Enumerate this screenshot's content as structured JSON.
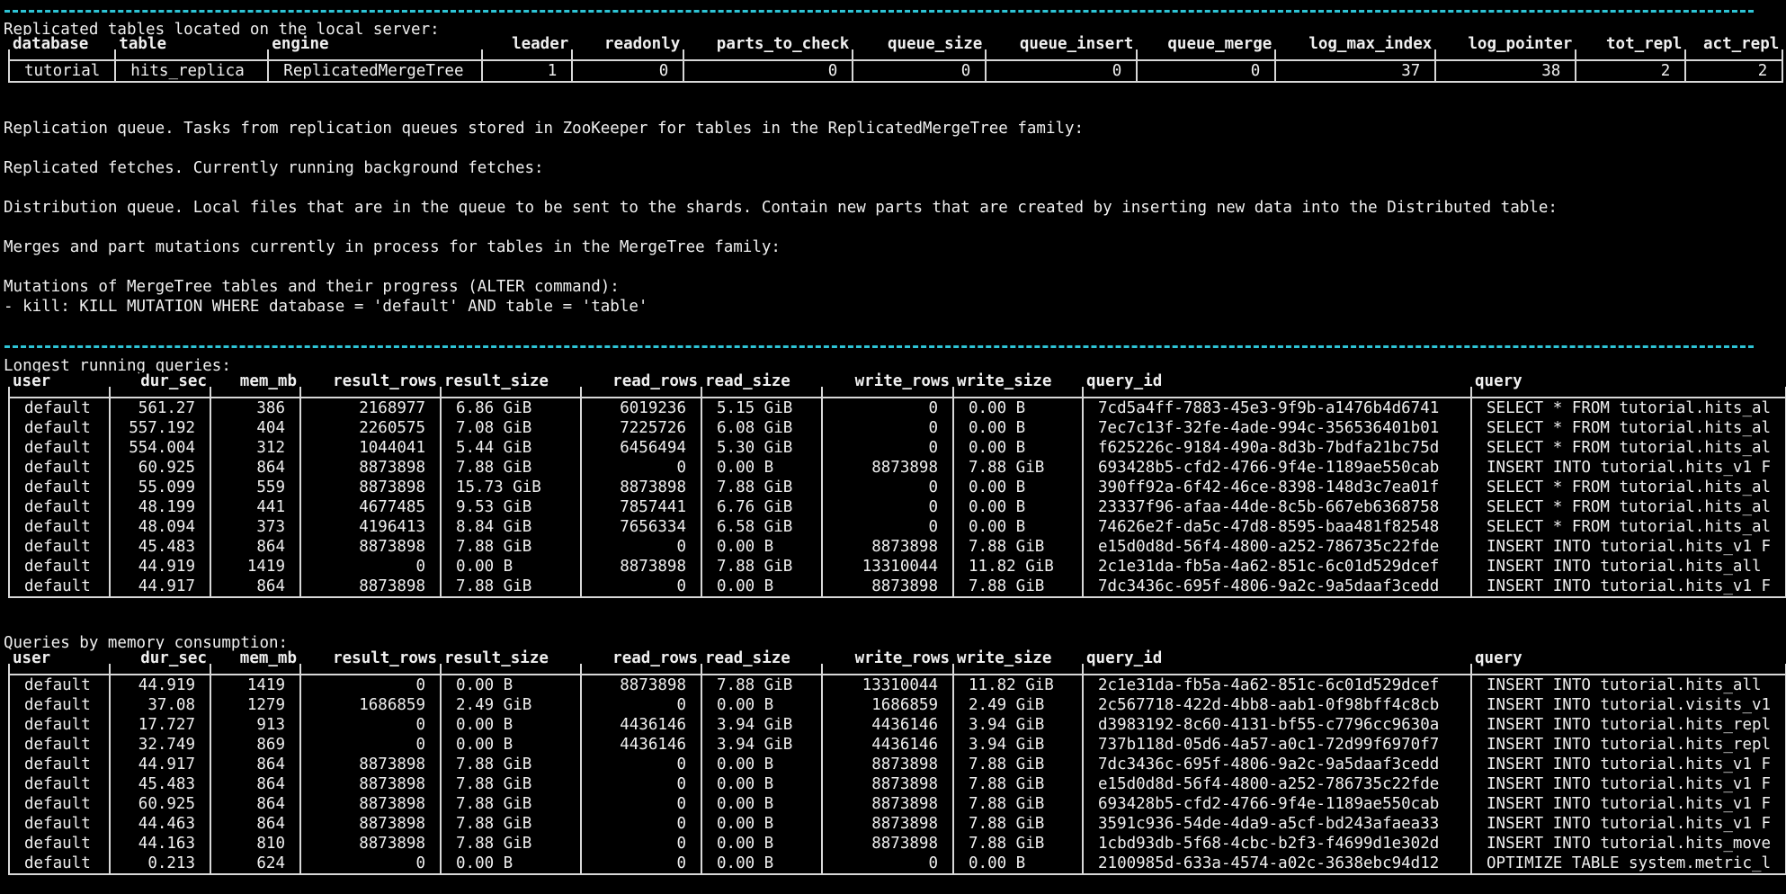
{
  "colors": {
    "background": "#000000",
    "text": "#f0f0f0",
    "separator": "#2ec4d6",
    "border": "#d8d8d8"
  },
  "replicated": {
    "heading": "Replicated tables located on the local server:",
    "columns": [
      "database",
      "table",
      "engine",
      "leader",
      "readonly",
      "parts_to_check",
      "queue_size",
      "queue_insert",
      "queue_merge",
      "log_max_index",
      "log_pointer",
      "tot_repl",
      "act_repl"
    ],
    "rows": [
      [
        "tutorial",
        "hits_replica",
        "ReplicatedMergeTree",
        "1",
        "0",
        "0",
        "0",
        "0",
        "0",
        "37",
        "38",
        "2",
        "2"
      ]
    ]
  },
  "sections": {
    "replication_queue": "Replication queue. Tasks from replication queues stored in ZooKeeper for tables in the ReplicatedMergeTree family:",
    "replicated_fetches": "Replicated fetches. Currently running background fetches:",
    "distribution_queue": "Distribution queue. Local files that are in the queue to be sent to the shards. Contain new parts that are created by inserting new data into the Distributed table:",
    "merges": "Merges and part mutations currently in process for tables in the MergeTree family:",
    "mutations": "Mutations of MergeTree tables and their progress (ALTER command):",
    "kill_hint": "- kill: KILL MUTATION WHERE database = 'default' AND table = 'table'"
  },
  "longest": {
    "heading": "Longest running queries:",
    "columns": [
      "user",
      "dur_sec",
      "mem_mb",
      "result_rows",
      "result_size",
      "read_rows",
      "read_size",
      "write_rows",
      "write_size",
      "query_id",
      "query"
    ],
    "rows": [
      [
        "default",
        "561.27",
        "386",
        "2168977",
        "6.86 GiB",
        "6019236",
        "5.15 GiB",
        "0",
        "0.00 B",
        "7cd5a4ff-7883-45e3-9f9b-a1476b4d6741",
        "SELECT * FROM tutorial.hits_al"
      ],
      [
        "default",
        "557.192",
        "404",
        "2260575",
        "7.08 GiB",
        "7225726",
        "6.08 GiB",
        "0",
        "0.00 B",
        "7ec7c13f-32fe-4ade-994c-356536401b01",
        "SELECT * FROM tutorial.hits_al"
      ],
      [
        "default",
        "554.004",
        "312",
        "1044041",
        "5.44 GiB",
        "6456494",
        "5.30 GiB",
        "0",
        "0.00 B",
        "f625226c-9184-490a-8d3b-7bdfa21bc75d",
        "SELECT * FROM tutorial.hits_al"
      ],
      [
        "default",
        "60.925",
        "864",
        "8873898",
        "7.88 GiB",
        "0",
        "0.00 B",
        "8873898",
        "7.88 GiB",
        "693428b5-cfd2-4766-9f4e-1189ae550cab",
        "INSERT INTO tutorial.hits_v1 F"
      ],
      [
        "default",
        "55.099",
        "559",
        "8873898",
        "15.73 GiB",
        "8873898",
        "7.88 GiB",
        "0",
        "0.00 B",
        "390ff92a-6f42-46ce-8398-148d3c7ea01f",
        "SELECT * FROM tutorial.hits_al"
      ],
      [
        "default",
        "48.199",
        "441",
        "4677485",
        "9.53 GiB",
        "7857441",
        "6.76 GiB",
        "0",
        "0.00 B",
        "23337f96-afaa-44de-8c5b-667eb6368758",
        "SELECT * FROM tutorial.hits_al"
      ],
      [
        "default",
        "48.094",
        "373",
        "4196413",
        "8.84 GiB",
        "7656334",
        "6.58 GiB",
        "0",
        "0.00 B",
        "74626e2f-da5c-47d8-8595-baa481f82548",
        "SELECT * FROM tutorial.hits_al"
      ],
      [
        "default",
        "45.483",
        "864",
        "8873898",
        "7.88 GiB",
        "0",
        "0.00 B",
        "8873898",
        "7.88 GiB",
        "e15d0d8d-56f4-4800-a252-786735c22fde",
        "INSERT INTO tutorial.hits_v1 F"
      ],
      [
        "default",
        "44.919",
        "1419",
        "0",
        "0.00 B",
        "8873898",
        "7.88 GiB",
        "13310044",
        "11.82 GiB",
        "2c1e31da-fb5a-4a62-851c-6c01d529dcef",
        "INSERT INTO tutorial.hits_all"
      ],
      [
        "default",
        "44.917",
        "864",
        "8873898",
        "7.88 GiB",
        "0",
        "0.00 B",
        "8873898",
        "7.88 GiB",
        "7dc3436c-695f-4806-9a2c-9a5daaf3cedd",
        "INSERT INTO tutorial.hits_v1 F"
      ]
    ]
  },
  "memory": {
    "heading": "Queries by memory consumption:",
    "columns": [
      "user",
      "dur_sec",
      "mem_mb",
      "result_rows",
      "result_size",
      "read_rows",
      "read_size",
      "write_rows",
      "write_size",
      "query_id",
      "query"
    ],
    "rows": [
      [
        "default",
        "44.919",
        "1419",
        "0",
        "0.00 B",
        "8873898",
        "7.88 GiB",
        "13310044",
        "11.82 GiB",
        "2c1e31da-fb5a-4a62-851c-6c01d529dcef",
        "INSERT INTO tutorial.hits_all"
      ],
      [
        "default",
        "37.08",
        "1279",
        "1686859",
        "2.49 GiB",
        "0",
        "0.00 B",
        "1686859",
        "2.49 GiB",
        "2c567718-422d-4bb8-aab1-0f98bff4c8cb",
        "INSERT INTO tutorial.visits_v1"
      ],
      [
        "default",
        "17.727",
        "913",
        "0",
        "0.00 B",
        "4436146",
        "3.94 GiB",
        "4436146",
        "3.94 GiB",
        "d3983192-8c60-4131-bf55-c7796cc9630a",
        "INSERT INTO tutorial.hits_repl"
      ],
      [
        "default",
        "32.749",
        "869",
        "0",
        "0.00 B",
        "4436146",
        "3.94 GiB",
        "4436146",
        "3.94 GiB",
        "737b118d-05d6-4a57-a0c1-72d99f6970f7",
        "INSERT INTO tutorial.hits_repl"
      ],
      [
        "default",
        "44.917",
        "864",
        "8873898",
        "7.88 GiB",
        "0",
        "0.00 B",
        "8873898",
        "7.88 GiB",
        "7dc3436c-695f-4806-9a2c-9a5daaf3cedd",
        "INSERT INTO tutorial.hits_v1 F"
      ],
      [
        "default",
        "45.483",
        "864",
        "8873898",
        "7.88 GiB",
        "0",
        "0.00 B",
        "8873898",
        "7.88 GiB",
        "e15d0d8d-56f4-4800-a252-786735c22fde",
        "INSERT INTO tutorial.hits_v1 F"
      ],
      [
        "default",
        "60.925",
        "864",
        "8873898",
        "7.88 GiB",
        "0",
        "0.00 B",
        "8873898",
        "7.88 GiB",
        "693428b5-cfd2-4766-9f4e-1189ae550cab",
        "INSERT INTO tutorial.hits_v1 F"
      ],
      [
        "default",
        "44.463",
        "864",
        "8873898",
        "7.88 GiB",
        "0",
        "0.00 B",
        "8873898",
        "7.88 GiB",
        "3591c936-54de-4da9-a5cf-bd243afaea33",
        "INSERT INTO tutorial.hits_v1 F"
      ],
      [
        "default",
        "44.163",
        "810",
        "8873898",
        "7.88 GiB",
        "0",
        "0.00 B",
        "8873898",
        "7.88 GiB",
        "1cbd93db-5f68-4cbc-b2f3-f4699d1e302d",
        "INSERT INTO tutorial.hits_move"
      ],
      [
        "default",
        "0.213",
        "624",
        "0",
        "0.00 B",
        "0",
        "0.00 B",
        "0",
        "0.00 B",
        "2100985d-633a-4574-a02c-3638ebc94d12",
        "OPTIMIZE TABLE system.metric_l"
      ]
    ]
  }
}
